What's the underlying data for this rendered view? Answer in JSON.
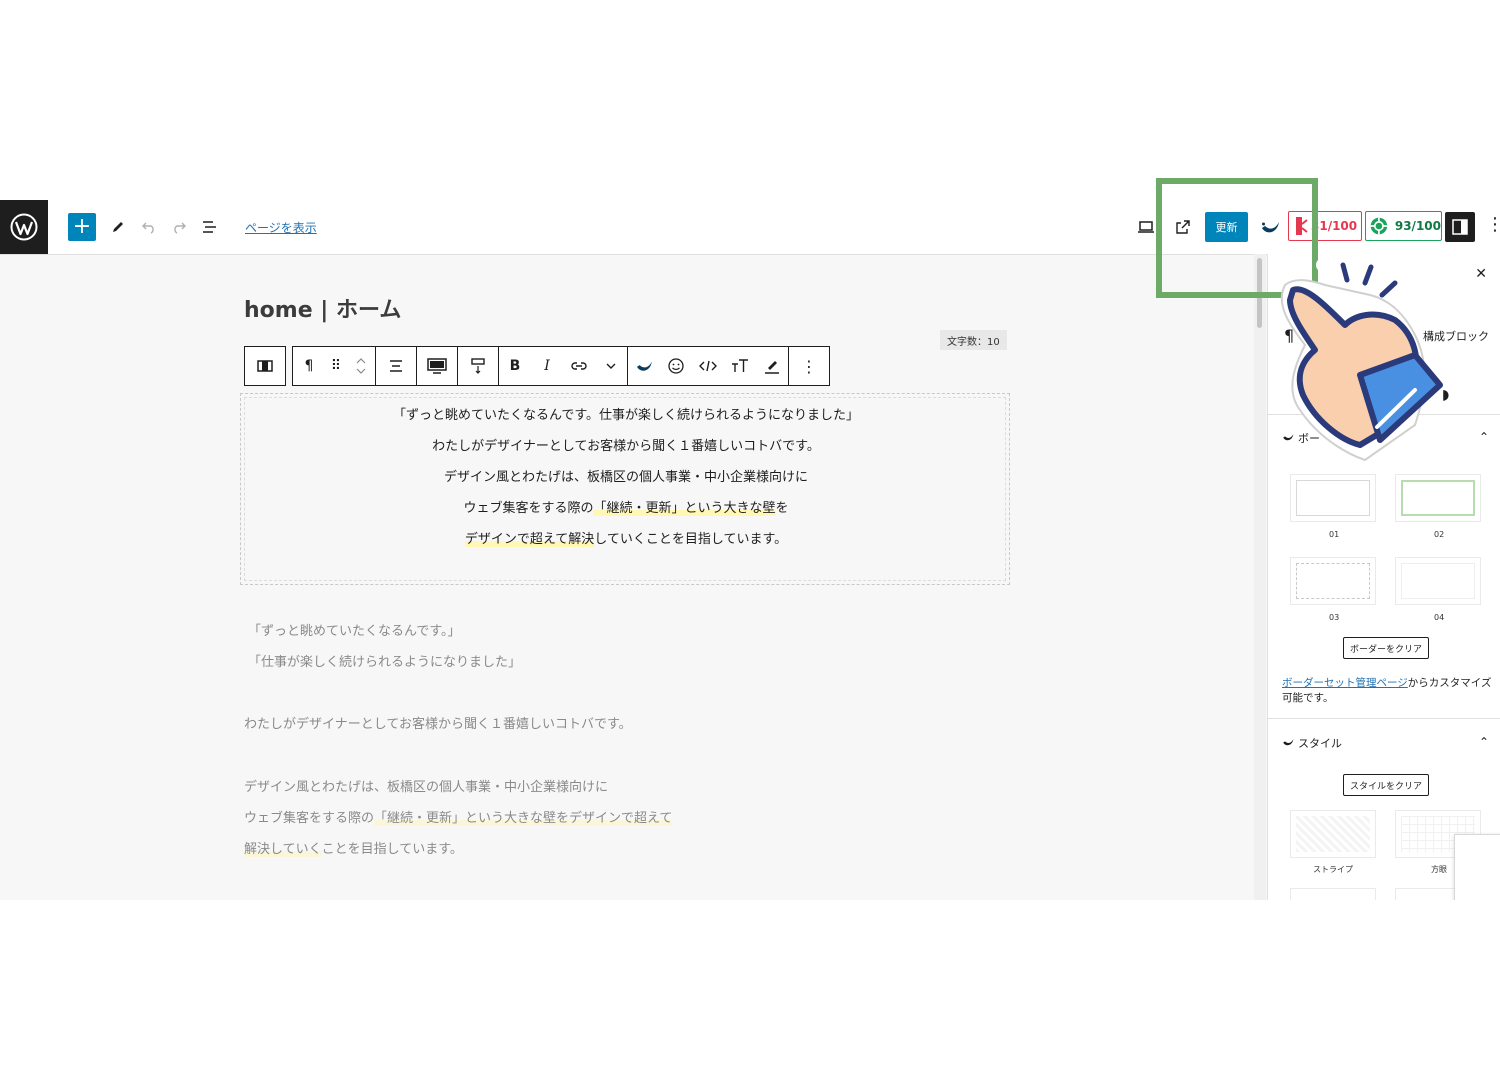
{
  "topbar": {
    "view_page_label": "ページを表示",
    "update_label": "更新",
    "score_red": "31/100",
    "score_green": "93/100"
  },
  "page": {
    "title": "home | ホーム",
    "char_count": "文字数：10"
  },
  "selected_block": {
    "lines": [
      {
        "a": "「ずっと眺めていたくなるんです。仕事が楽しく続けられるようになりました」"
      },
      {
        "a": "わたしがデザイナーとしてお客様から聞く１番嬉しいコトバです。"
      },
      {
        "a": "デザイン風とわたげは、板橋区の個人事業・中小企業様向けに"
      },
      {
        "a": "ウェブ集客をする際の",
        "hl": "「継続・更新」という大きな壁",
        "b": "を"
      },
      {
        "hl": "デザインで超えて解決",
        "b": "していくことを目指しています。"
      }
    ]
  },
  "body_text": {
    "lines": [
      {
        "a": "「ずっと眺めていたくなるんです。」"
      },
      {
        "a": "「仕事が楽しく続けられるようになりました」"
      },
      {
        "a": "わたしがデザイナーとしてお客様から聞く１番嬉しいコトバです。"
      },
      {
        "a": "デザイン風とわたげは、板橋区の個人事業・中小企業様向けに"
      },
      {
        "a": "ウェブ集客をする際の",
        "hl": "「継続・更新」という大きな壁をデザインで超えて"
      },
      {
        "hl": "解決していく",
        "b": "ことを目指しています。"
      }
    ]
  },
  "sidebar": {
    "tab_label": "構成ブロック",
    "border_section_label": "ボー",
    "border_presets": [
      "01",
      "02",
      "03",
      "04"
    ],
    "clear_border_label": "ボーダーをクリア",
    "link_text": "ボーダーセット管理ページ",
    "link_suffix": "からカスタマイズ可能です。",
    "style_section_label": "スタイル",
    "clear_style_label": "スタイルをクリア",
    "style_presets": [
      "ストライプ",
      "方眼"
    ]
  },
  "colors": {
    "accent": "#0085ba",
    "highlight_box": "#6daa68",
    "score_red": "#e5384f",
    "score_green": "#1aa35b"
  }
}
